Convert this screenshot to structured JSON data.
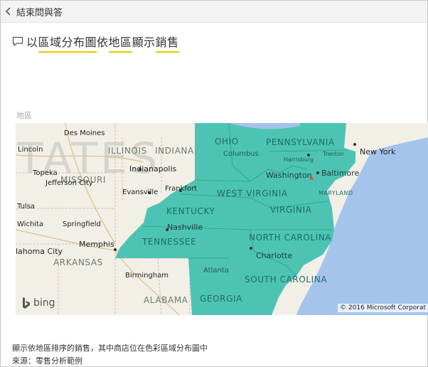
{
  "topbar": {
    "back_label": "結束問與答"
  },
  "question": {
    "segments": [
      "以",
      "區域分布圖",
      "依",
      "地區",
      "顯示",
      "銷售"
    ]
  },
  "map": {
    "title": "地區",
    "watermark": "TATES",
    "copyright": "© 2016 Microsoft Corporat",
    "bing_label": "bing",
    "fill_color": "#3bbfad",
    "water_color": "#a4c4ec",
    "states": {
      "illinois": "ILLINOIS",
      "indiana": "INDIANA",
      "ohio": "OHIO",
      "pennsylvania": "PENNSYLVANIA",
      "west_virginia": "WEST VIRGINIA",
      "virginia": "VIRGINIA",
      "kentucky": "KENTUCKY",
      "missouri": "MISSOURI",
      "tennessee": "TENNESSEE",
      "north_carolina": "NORTH CAROLINA",
      "arkansas": "ARKANSAS",
      "south_carolina": "SOUTH CAROLINA",
      "alabama": "ALABAMA",
      "georgia": "GEORGIA",
      "maryland": "MARYLAND"
    },
    "cities": {
      "des_moines": "Des Moines",
      "lincoln": "Lincoln",
      "topeka": "Topeka",
      "jefferson_city": "Jefferson City",
      "indianapolis": "Indianapolis",
      "evansville": "Evansville",
      "frankfort": "Frankfort",
      "columbus": "Columbus",
      "harrisburg": "Harrisburg",
      "trenton": "Trenton",
      "new_york": "New York",
      "washington": "Washington",
      "baltimore": "Baltimore",
      "nashville": "Nashville",
      "memphis": "Memphis",
      "oklahoma_city": "lahoma City",
      "charlotte": "Charlotte",
      "birmingham": "Birmingham",
      "atlanta": "Atlanta",
      "tulsa": "Tulsa",
      "wichita": "Wichita",
      "springfield": "Springfield"
    }
  },
  "footer": {
    "description": "顯示依地區排序的銷售，其中商店位在色彩區域分布圖中",
    "source": "來源：零售分析範例"
  }
}
